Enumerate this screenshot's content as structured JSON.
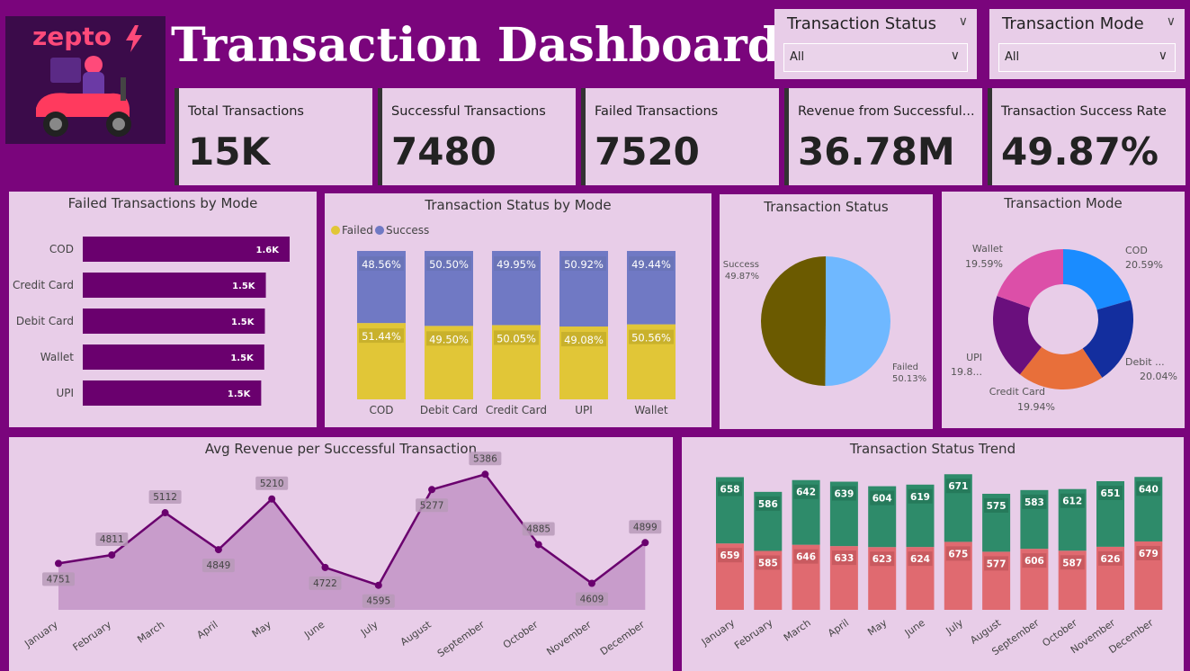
{
  "header": {
    "title": "Transaction Dashboard",
    "logo_text": "zepto"
  },
  "slicers": [
    {
      "label": "Transaction Status",
      "value": "All"
    },
    {
      "label": "Transaction Mode",
      "value": "All"
    }
  ],
  "kpis": [
    {
      "label": "Total Transactions",
      "value": "15K"
    },
    {
      "label": "Successful Transactions",
      "value": "7480"
    },
    {
      "label": "Failed Transactions",
      "value": "7520"
    },
    {
      "label": "Revenue from Successful...",
      "value": "36.78M"
    },
    {
      "label": "Transaction Success Rate",
      "value": "49.87%"
    }
  ],
  "colors": {
    "background": "#7a057c",
    "panel": "#e8cde8",
    "bar_purple": "#6a006e",
    "success_blue": "#7079c4",
    "failed_yellow": "#e1c637",
    "pie_success": "#6b5a00",
    "pie_failed": "#6fb8ff",
    "trend_success": "#2e8b6a",
    "trend_failed": "#e06a70"
  },
  "panels": {
    "failed_by_mode": "Failed Transactions by Mode",
    "status_by_mode": "Transaction Status by Mode",
    "status_pie": "Transaction Status",
    "mode_donut": "Transaction Mode",
    "avg_revenue": "Avg Revenue per Successful Transaction",
    "status_trend": "Transaction Status Trend"
  },
  "chart_data": [
    {
      "type": "bar",
      "title": "Failed Transactions by Mode",
      "orientation": "horizontal",
      "categories": [
        "COD",
        "Credit Card",
        "Debit Card",
        "Wallet",
        "UPI"
      ],
      "values": [
        1600,
        1500,
        1500,
        1500,
        1500
      ],
      "value_labels": [
        "1.6K",
        "1.5K",
        "1.5K",
        "1.5K",
        "1.5K"
      ]
    },
    {
      "type": "bar",
      "title": "Transaction Status by Mode",
      "stacked": "100%",
      "categories": [
        "COD",
        "Debit Card",
        "Credit Card",
        "UPI",
        "Wallet"
      ],
      "legend": [
        "Failed",
        "Success"
      ],
      "series": [
        {
          "name": "Failed",
          "values": [
            51.44,
            49.5,
            50.05,
            49.08,
            50.56
          ],
          "labels": [
            "51.44%",
            "49.50%",
            "50.05%",
            "49.08%",
            "50.56%"
          ]
        },
        {
          "name": "Success",
          "values": [
            48.56,
            50.5,
            49.95,
            50.92,
            49.44
          ],
          "labels": [
            "48.56%",
            "50.50%",
            "49.95%",
            "50.92%",
            "49.44%"
          ]
        }
      ]
    },
    {
      "type": "pie",
      "title": "Transaction Status",
      "slices": [
        {
          "name": "Success",
          "value": 49.87,
          "label": "49.87%"
        },
        {
          "name": "Failed",
          "value": 50.13,
          "label": "50.13%"
        }
      ]
    },
    {
      "type": "pie",
      "title": "Transaction Mode",
      "donut": true,
      "slices": [
        {
          "name": "COD",
          "value": 20.59,
          "label": "20.59%",
          "color": "#1a8cff"
        },
        {
          "name": "Debit ...",
          "value": 20.04,
          "label": "20.04%",
          "color": "#132e9e"
        },
        {
          "name": "Credit Card",
          "value": 19.94,
          "label": "19.94%",
          "color": "#e86f3a"
        },
        {
          "name": "UPI",
          "value": 19.84,
          "label": "19.8...",
          "color": "#6a0f7d"
        },
        {
          "name": "Wallet",
          "value": 19.59,
          "label": "19.59%",
          "color": "#dc4fa8"
        }
      ]
    },
    {
      "type": "area",
      "title": "Avg Revenue per Successful Transaction",
      "x": [
        "January",
        "February",
        "March",
        "April",
        "May",
        "June",
        "July",
        "August",
        "September",
        "October",
        "November",
        "December"
      ],
      "values": [
        4751,
        4811,
        5112,
        4849,
        5210,
        4722,
        4595,
        5277,
        5386,
        4885,
        4609,
        4899
      ],
      "ylim": [
        4420,
        5420
      ]
    },
    {
      "type": "bar",
      "title": "Transaction Status Trend",
      "stacked": true,
      "x": [
        "January",
        "February",
        "March",
        "April",
        "May",
        "June",
        "July",
        "August",
        "September",
        "October",
        "November",
        "December"
      ],
      "series": [
        {
          "name": "Failed",
          "values": [
            659,
            585,
            646,
            633,
            623,
            624,
            675,
            577,
            606,
            587,
            626,
            679
          ]
        },
        {
          "name": "Success",
          "values": [
            658,
            586,
            642,
            639,
            604,
            619,
            671,
            575,
            583,
            612,
            651,
            640
          ]
        }
      ]
    }
  ]
}
